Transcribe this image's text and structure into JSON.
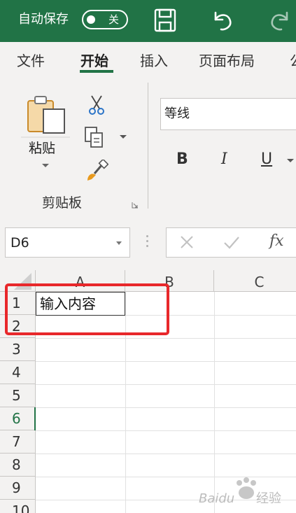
{
  "titlebar": {
    "autosave_label": "自动保存",
    "autosave_state": "关",
    "background": "#217346"
  },
  "tabs": {
    "file": "文件",
    "home": "开始",
    "insert": "插入",
    "page_layout": "页面布局",
    "partial_next": "公"
  },
  "ribbon": {
    "paste_label": "粘贴",
    "clipboard_group_label": "剪贴板",
    "font_name": "等线",
    "bold_label": "B",
    "italic_label": "I",
    "underline_label": "U"
  },
  "formula_bar": {
    "name_box_value": "D6",
    "fx_label": "fx"
  },
  "sheet": {
    "columns": [
      "A",
      "B",
      "C"
    ],
    "rows": [
      "1",
      "2",
      "3",
      "4",
      "5",
      "6",
      "7",
      "8",
      "9",
      "10"
    ],
    "active_row": "6",
    "cells": {
      "A1": "输入内容"
    }
  },
  "annotation": {
    "color": "#e8282b"
  },
  "watermark": {
    "text": "Baidu 经验"
  },
  "colors": {
    "accent": "#217346",
    "ribbon_bg": "#f3f2f1"
  },
  "icons": [
    "save-icon",
    "undo-icon",
    "redo-icon",
    "paste-icon",
    "cut-icon",
    "copy-icon",
    "format-painter-icon",
    "cancel-icon",
    "enter-icon",
    "fx-icon"
  ]
}
